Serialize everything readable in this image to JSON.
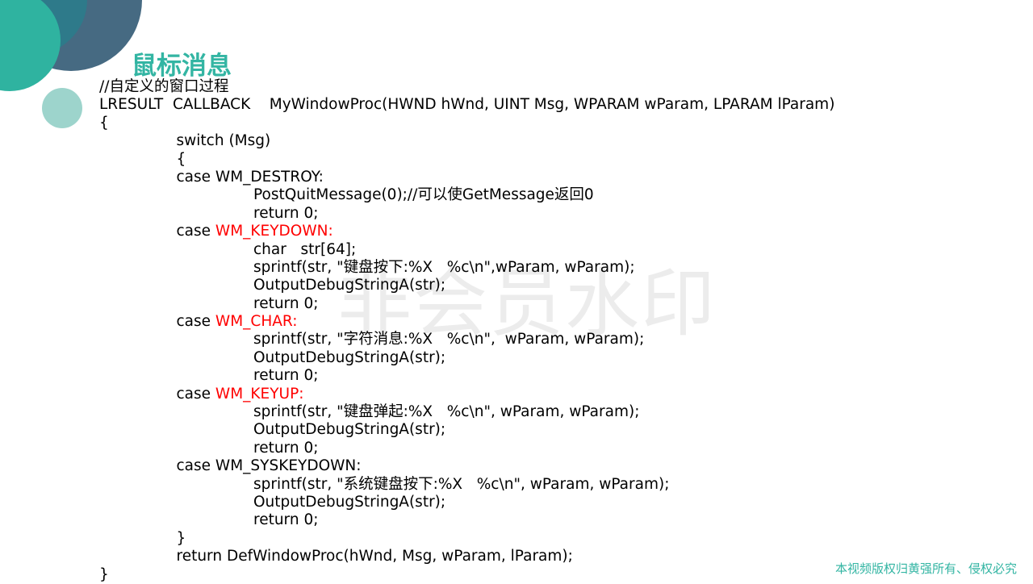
{
  "title": "鼠标消息",
  "watermark": "非会员水印",
  "footer": "本视频版权归黄强所有、侵权必究",
  "colors": {
    "title": "#33b5a3",
    "highlight": "#ff0000"
  },
  "code_lines": [
    {
      "indent": 0,
      "parts": [
        {
          "t": "//自定义的窗口过程"
        }
      ]
    },
    {
      "indent": 0,
      "parts": [
        {
          "t": "LRESULT  CALLBACK    MyWindowProc(HWND hWnd, UINT Msg, WPARAM wParam, LPARAM lParam)"
        }
      ]
    },
    {
      "indent": 0,
      "parts": [
        {
          "t": "{"
        }
      ]
    },
    {
      "indent": 1,
      "parts": [
        {
          "t": "switch (Msg)"
        }
      ]
    },
    {
      "indent": 1,
      "parts": [
        {
          "t": "{"
        }
      ]
    },
    {
      "indent": 1,
      "parts": [
        {
          "t": "case WM_DESTROY:"
        }
      ]
    },
    {
      "indent": 2,
      "parts": [
        {
          "t": "PostQuitMessage(0);//可以使GetMessage返回0"
        }
      ]
    },
    {
      "indent": 2,
      "parts": [
        {
          "t": "return 0;"
        }
      ]
    },
    {
      "indent": 1,
      "parts": [
        {
          "t": "case "
        },
        {
          "t": "WM_KEYDOWN:",
          "red": true
        }
      ]
    },
    {
      "indent": 2,
      "parts": [
        {
          "t": "char   str[64];"
        }
      ]
    },
    {
      "indent": 2,
      "parts": [
        {
          "t": "sprintf(str, \"键盘按下:%X   %c\\n\",wParam, wParam);"
        }
      ]
    },
    {
      "indent": 2,
      "parts": [
        {
          "t": "OutputDebugStringA(str);"
        }
      ]
    },
    {
      "indent": 2,
      "parts": [
        {
          "t": "return 0;"
        }
      ]
    },
    {
      "indent": 1,
      "parts": [
        {
          "t": "case "
        },
        {
          "t": "WM_CHAR:",
          "red": true
        }
      ]
    },
    {
      "indent": 2,
      "parts": [
        {
          "t": "sprintf(str, \"字符消息:%X   %c\\n\",  wParam, wParam);"
        }
      ]
    },
    {
      "indent": 2,
      "parts": [
        {
          "t": "OutputDebugStringA(str);"
        }
      ]
    },
    {
      "indent": 2,
      "parts": [
        {
          "t": "return 0;"
        }
      ]
    },
    {
      "indent": 1,
      "parts": [
        {
          "t": "case "
        },
        {
          "t": "WM_KEYUP:",
          "red": true
        }
      ]
    },
    {
      "indent": 2,
      "parts": [
        {
          "t": "sprintf(str, \"键盘弹起:%X   %c\\n\", wParam, wParam);"
        }
      ]
    },
    {
      "indent": 2,
      "parts": [
        {
          "t": "OutputDebugStringA(str);"
        }
      ]
    },
    {
      "indent": 2,
      "parts": [
        {
          "t": "return 0;"
        }
      ]
    },
    {
      "indent": 1,
      "parts": [
        {
          "t": "case WM_SYSKEYDOWN:"
        }
      ]
    },
    {
      "indent": 2,
      "parts": [
        {
          "t": "sprintf(str, \"系统键盘按下:%X   %c\\n\", wParam, wParam);"
        }
      ]
    },
    {
      "indent": 2,
      "parts": [
        {
          "t": "OutputDebugStringA(str);"
        }
      ]
    },
    {
      "indent": 2,
      "parts": [
        {
          "t": "return 0;"
        }
      ]
    },
    {
      "indent": 1,
      "parts": [
        {
          "t": "}"
        }
      ]
    },
    {
      "indent": 1,
      "parts": [
        {
          "t": "return DefWindowProc(hWnd, Msg, wParam, lParam);"
        }
      ]
    },
    {
      "indent": 0,
      "parts": [
        {
          "t": "}"
        }
      ]
    }
  ]
}
